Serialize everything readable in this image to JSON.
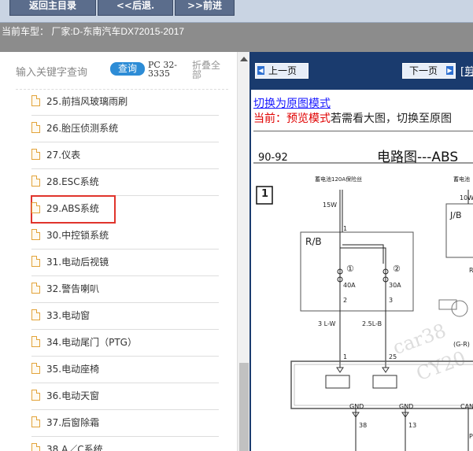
{
  "topbar": {
    "home_label": "返回主目录",
    "back_label": "<<后退.",
    "forward_label": ">>前进"
  },
  "infobar": {
    "text": "当前车型：  厂家:D-东南汽车DX72015-2017"
  },
  "search": {
    "placeholder": "输入关键字查询",
    "button_label": "查询",
    "code": "PC 32-3335",
    "collapse_label": "折叠全部"
  },
  "tree": {
    "items": [
      {
        "label": "25.前挡风玻璃雨刷"
      },
      {
        "label": "26.胎压侦测系统"
      },
      {
        "label": "27.仪表"
      },
      {
        "label": "28.ESC系统"
      },
      {
        "label": "29.ABS系统",
        "selected": true
      },
      {
        "label": "30.中控锁系统"
      },
      {
        "label": "31.电动后视镜"
      },
      {
        "label": "32.警告喇叭"
      },
      {
        "label": "33.电动窗"
      },
      {
        "label": "34.电动尾门（PTG）"
      },
      {
        "label": "35.电动座椅"
      },
      {
        "label": "36.电动天窗"
      },
      {
        "label": "37.后窗除霜"
      },
      {
        "label": "38.A／C系统"
      }
    ]
  },
  "pager": {
    "prev_label": "上一页",
    "next_label": "下一页",
    "extra_label": "[剪"
  },
  "content": {
    "switch_link": "切换为原图模式",
    "current_mode": "当前：预览模式",
    "mode_hint": "若需看大图，切换至原图"
  },
  "diagram": {
    "page_no": "90-92",
    "title": "电路图---ABS",
    "box_no": "1",
    "source1": "蓄电池120A保险丝",
    "source2": "蓄电池",
    "wire_15w": "15W",
    "wire_10w": "10W",
    "rb": "R/B",
    "jb": "J/B",
    "pin1": "1",
    "fuse1_num": "①",
    "fuse2_num": "②",
    "fuse1": "40A",
    "fuse2": "30A",
    "pin2": "2",
    "pin3": "3",
    "wire_a": "3 L-W",
    "wire_b": "2.5L-B",
    "conn1": "1",
    "conn25": "25",
    "gnd1": "GND",
    "gnd2": "GND",
    "can": "CAN",
    "pin38": "38",
    "pin13": "13",
    "gr": "(G-R)",
    "r": "R",
    "p": "P",
    "watermark1": "car38",
    "watermark2": "CY20"
  },
  "colors": {
    "accent": "#2d8cd6",
    "highlight": "#e0342c",
    "pager_bg": "#1a3b6e",
    "link": "#1a1aff",
    "mode_red": "#e00000"
  }
}
